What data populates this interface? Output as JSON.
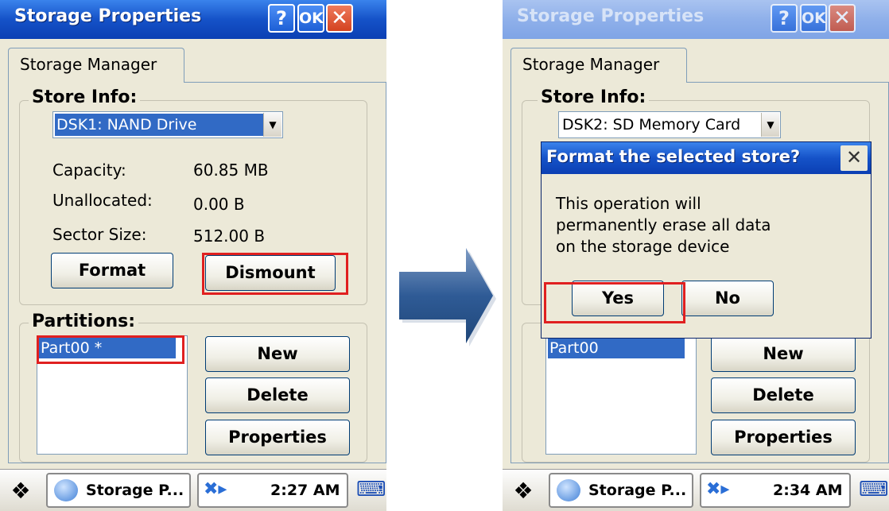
{
  "left": {
    "window_title": "Storage Properties",
    "help_label": "?",
    "ok_label": "OK",
    "close_label": "✕",
    "tab_label": "Storage Manager",
    "store_info_label": "Store Info:",
    "store_selected": "DSK1: NAND Drive",
    "capacity_label": "Capacity:",
    "capacity_value": "60.85 MB",
    "unallocated_label": "Unallocated:",
    "unallocated_value": "0.00 B",
    "sector_label": "Sector Size:",
    "sector_value": "512.00 B",
    "format_label": "Format",
    "dismount_label": "Dismount",
    "partitions_label": "Partitions:",
    "partition_item": "Part00 *",
    "new_label": "New",
    "delete_label": "Delete",
    "properties_label": "Properties",
    "task_label": "Storage P...",
    "clock": "2:27 AM"
  },
  "right": {
    "window_title": "Storage Properties",
    "help_label": "?",
    "ok_label": "OK",
    "close_label": "✕",
    "tab_label": "Storage Manager",
    "store_info_label": "Store Info:",
    "store_selected": "DSK2: SD Memory Card",
    "partition_item": "Part00",
    "new_label": "New",
    "delete_label": "Delete",
    "properties_label": "Properties",
    "task_label": "Storage P...",
    "clock": "2:34 AM",
    "dialog": {
      "title": "Format the selected store?",
      "close_label": "✕",
      "message": "This operation will\npermanently erase all data\non the storage device",
      "yes_label": "Yes",
      "no_label": "No"
    }
  },
  "colors": {
    "highlight": "#e02020",
    "selection": "#316ac5",
    "title_bar": "#1552c8"
  },
  "icons": {
    "start": "windows-flag-icon",
    "task": "globe-icon",
    "tray": "network-icon",
    "input": "keyboard-icon",
    "transition": "right-arrow-icon"
  }
}
